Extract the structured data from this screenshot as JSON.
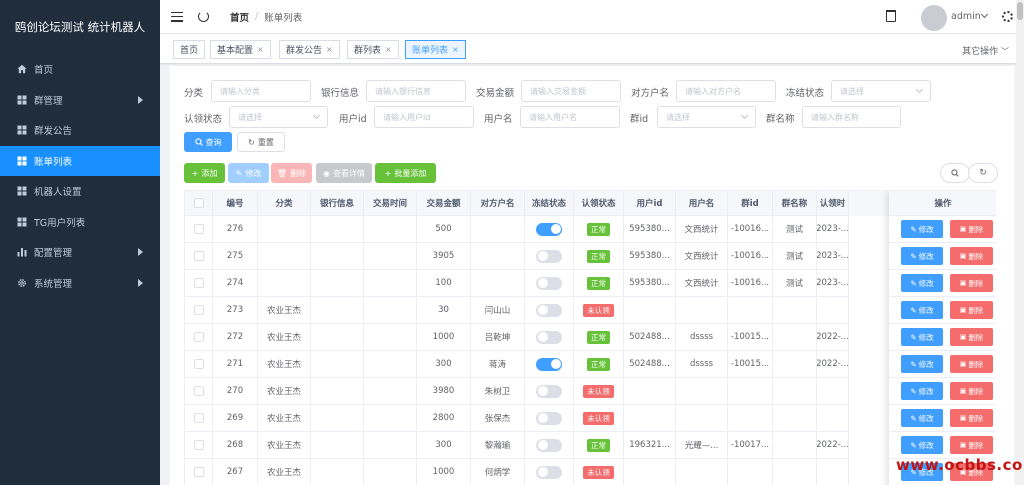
{
  "app": {
    "title": "鸥创论坛测试 统计机器人"
  },
  "sidebar": {
    "items": [
      {
        "label": "首页",
        "icon": "home-icon",
        "has_arrow": false,
        "active": false
      },
      {
        "label": "群管理",
        "icon": "grid-icon",
        "has_arrow": true,
        "active": false
      },
      {
        "label": "群发公告",
        "icon": "grid-icon",
        "has_arrow": false,
        "active": false
      },
      {
        "label": "账单列表",
        "icon": "grid-icon",
        "has_arrow": false,
        "active": true
      },
      {
        "label": "机器人设置",
        "icon": "grid-icon",
        "has_arrow": false,
        "active": false
      },
      {
        "label": "TG用户列表",
        "icon": "grid-icon",
        "has_arrow": false,
        "active": false
      },
      {
        "label": "配置管理",
        "icon": "bar-chart-icon",
        "has_arrow": true,
        "active": false
      },
      {
        "label": "系统管理",
        "icon": "gear-icon",
        "has_arrow": true,
        "active": false
      }
    ]
  },
  "header": {
    "breadcrumb_home": "首页",
    "breadcrumb_sep": "/",
    "breadcrumb_current": "账单列表",
    "username": "admin"
  },
  "tags": {
    "items": [
      {
        "label": "首页",
        "closable": false,
        "active": false
      },
      {
        "label": "基本配置",
        "closable": true,
        "active": false
      },
      {
        "label": "群发公告",
        "closable": true,
        "active": false
      },
      {
        "label": "群列表",
        "closable": true,
        "active": false
      },
      {
        "label": "账单列表",
        "closable": true,
        "active": true
      }
    ],
    "close_glyph": "×",
    "other_ops": "其它操作"
  },
  "filters": {
    "category_label": "分类",
    "category_ph": "请输入分类",
    "bank_label": "银行信息",
    "bank_ph": "请输入银行信息",
    "amount_label": "交易金额",
    "amount_ph": "请输入交易金额",
    "counterparty_label": "对方户名",
    "counterparty_ph": "请输入对方户名",
    "freeze_label": "冻结状态",
    "freeze_ph": "请选择",
    "verify_label": "认领状态",
    "verify_ph": "请选择",
    "userid_label": "用户id",
    "userid_ph": "请输入用户id",
    "username_label": "用户名",
    "username_ph": "请输入用户名",
    "groupid_label": "群id",
    "groupid_ph": "请选择",
    "groupname_label": "群名称",
    "groupname_ph": "请输入群名称",
    "search_btn": "查询",
    "reset_btn": "重置"
  },
  "toolbar": {
    "add": "添加",
    "edit": "修改",
    "delete": "删除",
    "details": "查看详情",
    "batch_add": "批量添加"
  },
  "table": {
    "columns": [
      "编号",
      "分类",
      "银行信息",
      "交易时间",
      "交易金额",
      "对方户名",
      "冻结状态",
      "认领状态",
      "用户id",
      "用户名",
      "群id",
      "群名称",
      "认领时"
    ],
    "op_header": "操作",
    "op_edit": "修改",
    "op_delete": "删除",
    "rows": [
      {
        "id": "276",
        "category": "",
        "bank": "",
        "time": "",
        "amount": "500",
        "counterparty": "",
        "frozen": true,
        "status": "正常",
        "status_ok": true,
        "userid": "595380...",
        "username": "文西统计",
        "groupid": "-10016...",
        "groupname": "测试",
        "claim_time": "2023-..."
      },
      {
        "id": "275",
        "category": "",
        "bank": "",
        "time": "",
        "amount": "3905",
        "counterparty": "",
        "frozen": false,
        "status": "正常",
        "status_ok": true,
        "userid": "595380...",
        "username": "文西统计",
        "groupid": "-10016...",
        "groupname": "测试",
        "claim_time": "2023-..."
      },
      {
        "id": "274",
        "category": "",
        "bank": "",
        "time": "",
        "amount": "100",
        "counterparty": "",
        "frozen": false,
        "status": "正常",
        "status_ok": true,
        "userid": "595380...",
        "username": "文西统计",
        "groupid": "-10016...",
        "groupname": "测试",
        "claim_time": "2023-..."
      },
      {
        "id": "273",
        "category": "农业王杰",
        "bank": "",
        "time": "",
        "amount": "30",
        "counterparty": "闫山山",
        "frozen": false,
        "status": "未认领",
        "status_ok": false,
        "userid": "",
        "username": "",
        "groupid": "",
        "groupname": "",
        "claim_time": ""
      },
      {
        "id": "272",
        "category": "农业王杰",
        "bank": "",
        "time": "",
        "amount": "1000",
        "counterparty": "吕乾坤",
        "frozen": false,
        "status": "正常",
        "status_ok": true,
        "userid": "502488...",
        "username": "dssss",
        "groupid": "-10015...",
        "groupname": "",
        "claim_time": "2022-..."
      },
      {
        "id": "271",
        "category": "农业王杰",
        "bank": "",
        "time": "",
        "amount": "300",
        "counterparty": "蒋涛",
        "frozen": true,
        "status": "正常",
        "status_ok": true,
        "userid": "502488...",
        "username": "dssss",
        "groupid": "-10015...",
        "groupname": "",
        "claim_time": "2022-..."
      },
      {
        "id": "270",
        "category": "农业王杰",
        "bank": "",
        "time": "",
        "amount": "3980",
        "counterparty": "朱树卫",
        "frozen": false,
        "status": "未认领",
        "status_ok": false,
        "userid": "",
        "username": "",
        "groupid": "",
        "groupname": "",
        "claim_time": ""
      },
      {
        "id": "269",
        "category": "农业王杰",
        "bank": "",
        "time": "",
        "amount": "2800",
        "counterparty": "张保杰",
        "frozen": false,
        "status": "未认领",
        "status_ok": false,
        "userid": "",
        "username": "",
        "groupid": "",
        "groupname": "",
        "claim_time": ""
      },
      {
        "id": "268",
        "category": "农业王杰",
        "bank": "",
        "time": "",
        "amount": "300",
        "counterparty": "黎瀚瑜",
        "frozen": false,
        "status": "正常",
        "status_ok": true,
        "userid": "196321...",
        "username": "光耀—...",
        "groupid": "-10017...",
        "groupname": "",
        "claim_time": "2022-..."
      },
      {
        "id": "267",
        "category": "农业王杰",
        "bank": "",
        "time": "",
        "amount": "1000",
        "counterparty": "何炳学",
        "frozen": false,
        "status": "未认领",
        "status_ok": false,
        "userid": "",
        "username": "",
        "groupid": "",
        "groupname": "",
        "claim_time": ""
      }
    ]
  },
  "watermark": "www.ocbbs.com",
  "colors": {
    "sidebar_bg": "#1f2d3d",
    "active": "#1890ff",
    "primary": "#409eff",
    "success": "#67c23a",
    "danger": "#f56c6c"
  }
}
